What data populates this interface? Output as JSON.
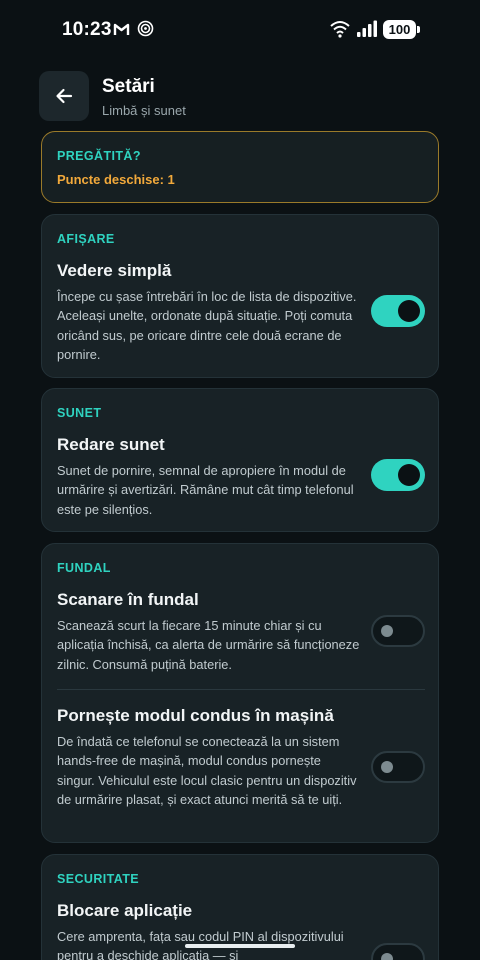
{
  "status_bar": {
    "time": "10:23",
    "battery": "100"
  },
  "header": {
    "title": "Setări",
    "subtitle": "Limbă și sunet"
  },
  "ready_card": {
    "label": "PREGĂTITĂ?",
    "open_points": "Puncte deschise: 1"
  },
  "display": {
    "label": "AFIȘARE",
    "title": "Vedere simplă",
    "desc": "Începe cu șase întrebări în loc de lista de dispozitive. Aceleași unelte, ordonate după situație. Poți comuta oricând sus, pe oricare dintre cele două ecrane de pornire.",
    "enabled": true
  },
  "sound": {
    "label": "SUNET",
    "title": "Redare sunet",
    "desc": "Sunet de pornire, semnal de apropiere în modul de urmărire și avertizări. Rămâne mut cât timp telefonul este pe silențios.",
    "enabled": true
  },
  "background": {
    "label": "FUNDAL",
    "scan_title": "Scanare în fundal",
    "scan_desc": "Scanează scurt la fiecare 15 minute chiar și cu aplicația închisă, ca alerta de urmărire să funcționeze zilnic. Consumă puțină baterie.",
    "scan_enabled": false,
    "drive_title": "Pornește modul condus în mașină",
    "drive_desc": "De îndată ce telefonul se conectează la un sistem hands-free de mașină, modul condus pornește singur. Vehiculul este locul clasic pentru un dispozitiv de urmărire plasat, și exact atunci merită să te uiți.",
    "drive_enabled": false
  },
  "security": {
    "label": "SECURITATE",
    "title": "Blocare aplicație",
    "desc": "Cere amprenta, fața sau codul PIN al dispozitivului pentru a deschide aplicația — și",
    "enabled": false
  },
  "colors": {
    "accent": "#2fd3c0",
    "warning": "#f2a93b",
    "background": "#0b1114",
    "card": "#182226"
  }
}
